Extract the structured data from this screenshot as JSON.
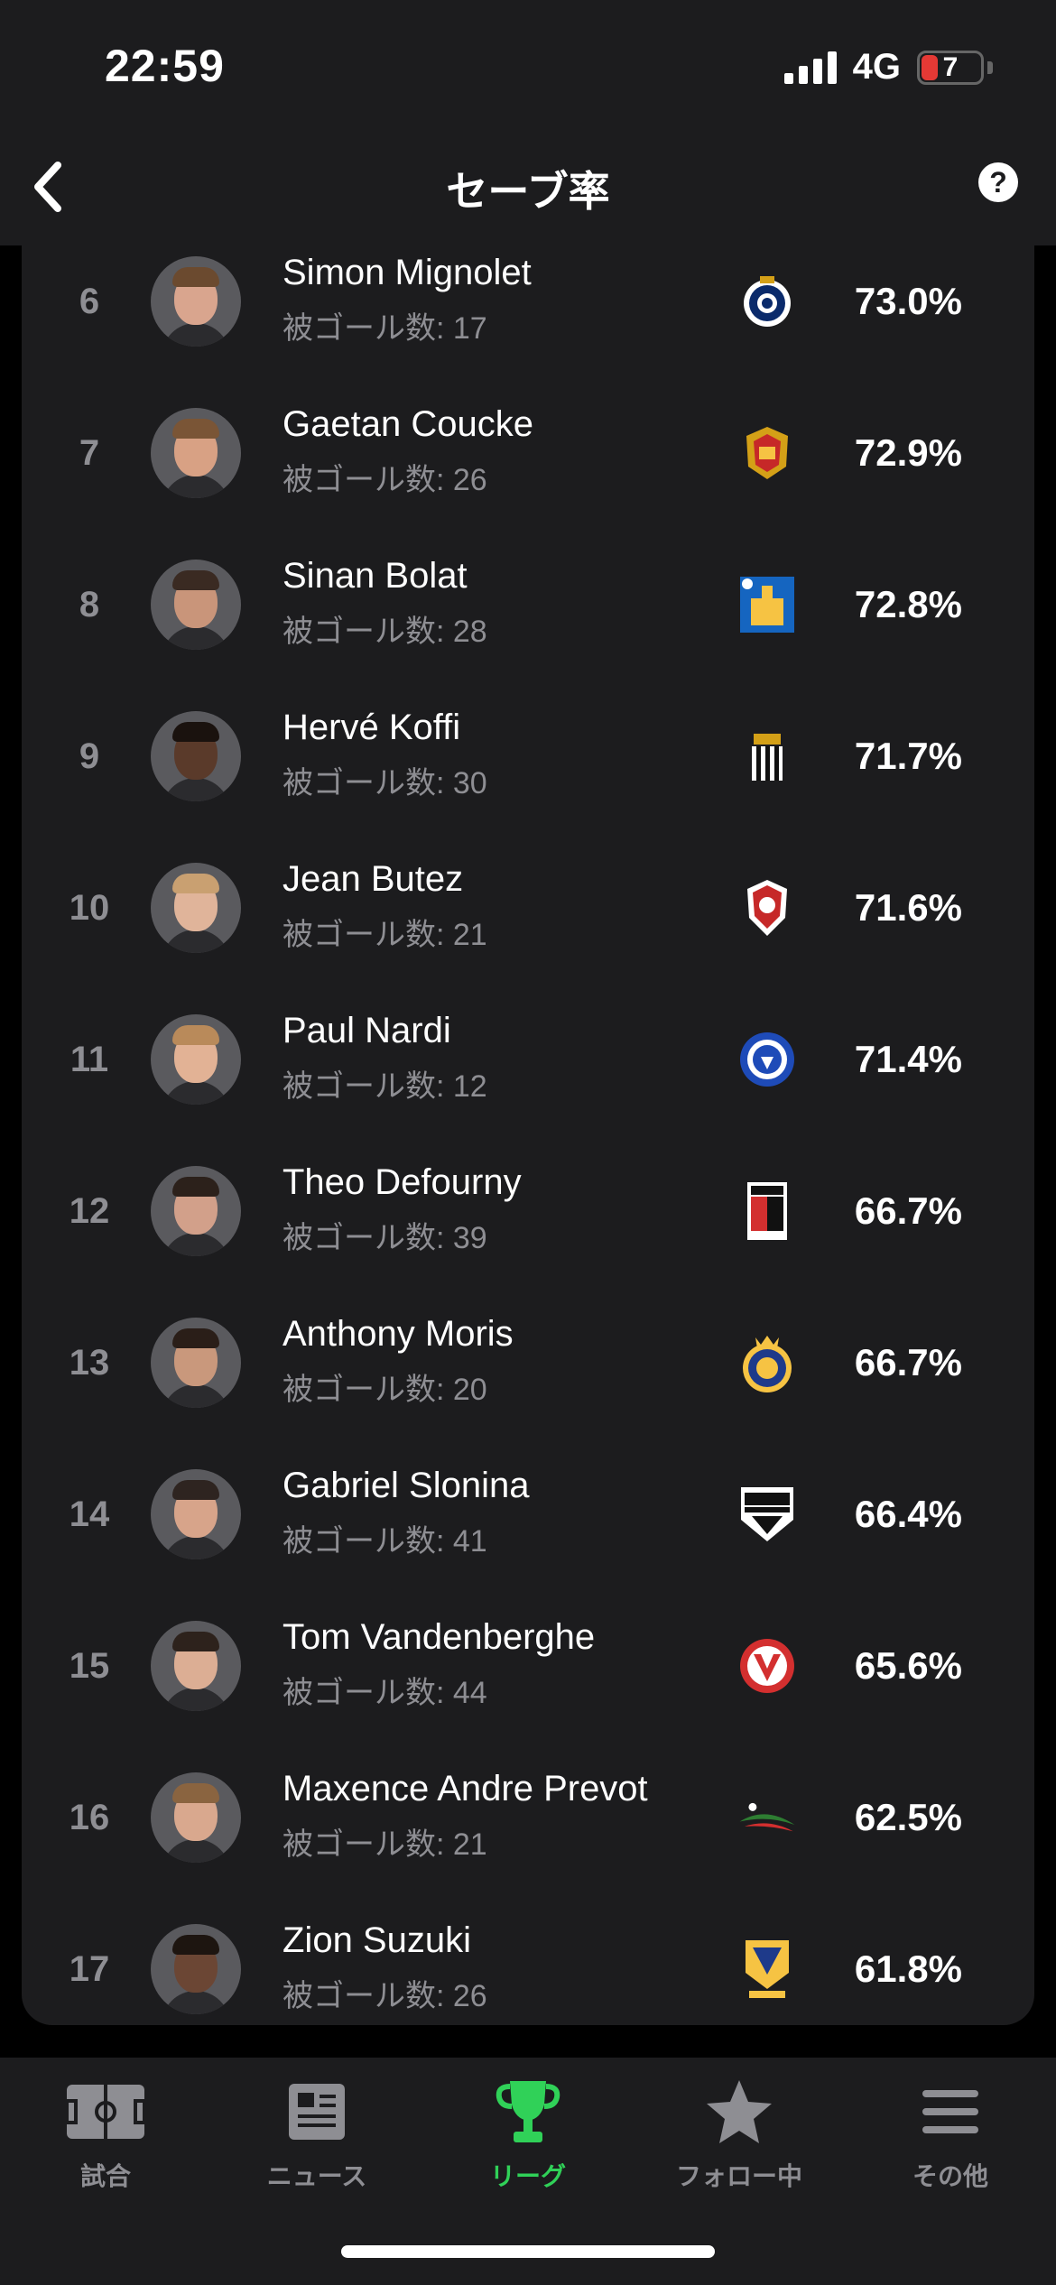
{
  "status": {
    "time": "22:59",
    "network": "4G",
    "battery": "7"
  },
  "header": {
    "title": "セーブ率",
    "back_icon": "chevron-left-icon",
    "help_label": "?"
  },
  "players": [
    {
      "rank": "6",
      "name": "Simon Mignolet",
      "goals": "被ゴール数: 17",
      "pct": "73.0%",
      "crest": "club-brugge-crest",
      "skin": "#d9a58e",
      "hair": "#6b4a2f"
    },
    {
      "rank": "7",
      "name": "Gaetan Coucke",
      "goals": "被ゴール数: 26",
      "pct": "72.9%",
      "crest": "mechelen-crest",
      "skin": "#d8a184",
      "hair": "#7a5536"
    },
    {
      "rank": "8",
      "name": "Sinan Bolat",
      "goals": "被ゴール数: 28",
      "pct": "72.8%",
      "crest": "westerlo-crest",
      "skin": "#c9957a",
      "hair": "#3a2a22"
    },
    {
      "rank": "9",
      "name": "Hervé Koffi",
      "goals": "被ゴール数: 30",
      "pct": "71.7%",
      "crest": "charleroi-crest",
      "skin": "#5a3a2a",
      "hair": "#1a120e"
    },
    {
      "rank": "10",
      "name": "Jean Butez",
      "goals": "被ゴール数: 21",
      "pct": "71.6%",
      "crest": "antwerp-crest",
      "skin": "#e0b49a",
      "hair": "#c9a071"
    },
    {
      "rank": "11",
      "name": "Paul Nardi",
      "goals": "被ゴール数: 12",
      "pct": "71.4%",
      "crest": "gent-crest",
      "skin": "#e2b295",
      "hair": "#b98a5a"
    },
    {
      "rank": "12",
      "name": "Theo Defourny",
      "goals": "被ゴール数: 39",
      "pct": "66.7%",
      "crest": "rwd-molenbeek-crest",
      "skin": "#d2a08a",
      "hair": "#2c211b"
    },
    {
      "rank": "13",
      "name": "Anthony Moris",
      "goals": "被ゴール数: 20",
      "pct": "66.7%",
      "crest": "union-sg-crest",
      "skin": "#c9987c",
      "hair": "#2a1e18"
    },
    {
      "rank": "14",
      "name": "Gabriel Slonina",
      "goals": "被ゴール数: 41",
      "pct": "66.4%",
      "crest": "eupen-crest",
      "skin": "#d7a48a",
      "hair": "#2e2420"
    },
    {
      "rank": "15",
      "name": "Tom Vandenberghe",
      "goals": "被ゴール数: 44",
      "pct": "65.6%",
      "crest": "kortrijk-crest",
      "skin": "#dcae94",
      "hair": "#2d221c"
    },
    {
      "rank": "16",
      "name": "Maxence Andre Prevot",
      "goals": "被ゴール数: 21",
      "pct": "62.5%",
      "crest": "ohl-crest",
      "skin": "#d9a88e",
      "hair": "#8a6440"
    },
    {
      "rank": "17",
      "name": "Zion Suzuki",
      "goals": "被ゴール数: 26",
      "pct": "61.8%",
      "crest": "stvv-crest",
      "skin": "#6b4634",
      "hair": "#1d1510"
    }
  ],
  "tabs": [
    {
      "label": "試合",
      "icon": "pitch-icon"
    },
    {
      "label": "ニュース",
      "icon": "news-icon"
    },
    {
      "label": "リーグ",
      "icon": "trophy-icon"
    },
    {
      "label": "フォロー中",
      "icon": "star-icon"
    },
    {
      "label": "その他",
      "icon": "menu-icon"
    }
  ],
  "colors": {
    "accent": "#30d158",
    "card": "#1c1c1e",
    "muted": "#8e8e93"
  }
}
